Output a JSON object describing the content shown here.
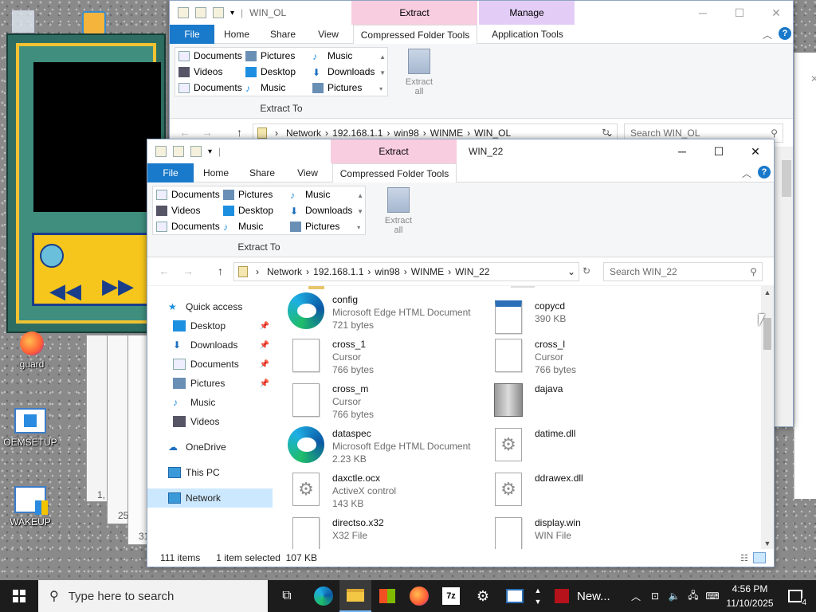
{
  "desktop": {
    "icons": [
      {
        "label": "guard"
      },
      {
        "label": "OEMSETUP"
      },
      {
        "label": "WAKEUP"
      }
    ],
    "behind_labels": [
      "1,",
      "25",
      "31"
    ]
  },
  "back_window": {
    "qat_title": "WIN_OL",
    "context_tabs": {
      "extract": "Extract",
      "manage": "Manage"
    },
    "tabs": [
      "File",
      "Home",
      "Share",
      "View",
      "Compressed Folder Tools",
      "Application Tools"
    ],
    "ribbon": {
      "col1": [
        "Documents",
        "Videos",
        "Documents"
      ],
      "col2": [
        "Pictures",
        "Desktop",
        "Music"
      ],
      "col3": [
        "Music",
        "Downloads",
        "Pictures"
      ],
      "group_label": "Extract To",
      "extract_all": "Extract all"
    },
    "address": [
      "Network",
      "192.168.1.1",
      "win98",
      "WINME",
      "WIN_OL"
    ],
    "search_placeholder": "Search WIN_OL"
  },
  "front_window": {
    "title": "WIN_22",
    "context_tab": "Extract",
    "tabs": [
      "File",
      "Home",
      "Share",
      "View",
      "Compressed Folder Tools"
    ],
    "ribbon": {
      "col1": [
        "Documents",
        "Videos",
        "Documents"
      ],
      "col2": [
        "Pictures",
        "Desktop",
        "Music"
      ],
      "col3": [
        "Music",
        "Downloads",
        "Pictures"
      ],
      "group_label": "Extract To",
      "extract_all": "Extract all"
    },
    "address": [
      "Network",
      "192.168.1.1",
      "win98",
      "WINME",
      "WIN_22"
    ],
    "search_placeholder": "Search WIN_22",
    "nav": [
      {
        "label": "Quick access",
        "pinned": false
      },
      {
        "label": "Desktop",
        "pinned": true
      },
      {
        "label": "Downloads",
        "pinned": true
      },
      {
        "label": "Documents",
        "pinned": true
      },
      {
        "label": "Pictures",
        "pinned": true
      },
      {
        "label": "Music",
        "pinned": false
      },
      {
        "label": "Videos",
        "pinned": false
      },
      {
        "label": "OneDrive",
        "pinned": false
      },
      {
        "label": "This PC",
        "pinned": false
      },
      {
        "label": "Network",
        "pinned": false,
        "selected": true
      }
    ],
    "files_left": [
      {
        "name": "config",
        "type": "Microsoft Edge HTML Document",
        "size": "721 bytes",
        "icon": "edge-icon"
      },
      {
        "name": "cross_1",
        "type": "Cursor",
        "size": "766 bytes",
        "icon": "file-icon"
      },
      {
        "name": "cross_m",
        "type": "Cursor",
        "size": "766 bytes",
        "icon": "file-icon"
      },
      {
        "name": "dataspec",
        "type": "Microsoft Edge HTML Document",
        "size": "2.23 KB",
        "icon": "edge-icon"
      },
      {
        "name": "daxctle.ocx",
        "type": "ActiveX control",
        "size": "143 KB",
        "icon": "gear-file-icon"
      },
      {
        "name": "directso.x32",
        "type": "X32 File",
        "size": "",
        "icon": "file-icon"
      }
    ],
    "files_right": [
      {
        "name": "copycd",
        "type": "390 KB",
        "size": "",
        "icon": "clapper-icon"
      },
      {
        "name": "cross_l",
        "type": "Cursor",
        "size": "766 bytes",
        "icon": "file-icon"
      },
      {
        "name": "dajava",
        "type": "",
        "size": "",
        "icon": "cabinet-icon"
      },
      {
        "name": "datime.dll",
        "type": "",
        "size": "",
        "icon": "gear-file-icon"
      },
      {
        "name": "ddrawex.dll",
        "type": "",
        "size": "",
        "icon": "gear-file-icon"
      },
      {
        "name": "display.win",
        "type": "WIN File",
        "size": "",
        "icon": "file-icon"
      }
    ],
    "status": {
      "count": "111 items",
      "selected": "1 item selected  107 KB"
    }
  },
  "taskbar": {
    "search_placeholder": "Type here to search",
    "news": "New...",
    "time": "4:56 PM",
    "date": "11/10/2025",
    "notification_count": "4"
  },
  "colors": {
    "file_tab": "#1979ca",
    "extract_tab": "#f9cde0",
    "manage_tab": "#e3cdf6",
    "nav_selected": "#cce8ff"
  }
}
